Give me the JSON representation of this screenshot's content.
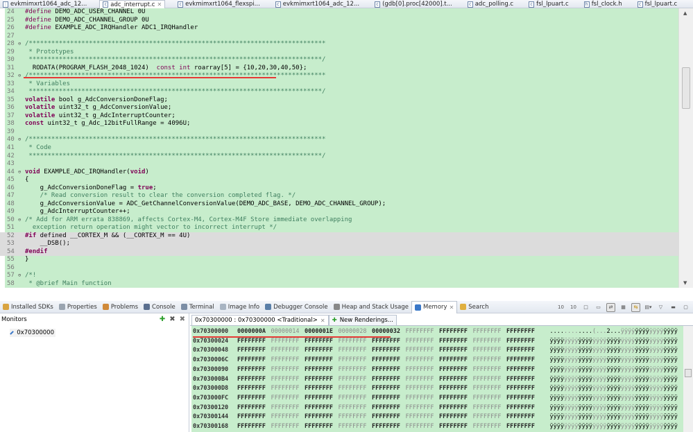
{
  "editor_tabs": [
    {
      "label": "evkmimxrt1064_adc_12...",
      "icon": "project-icon",
      "active": false
    },
    {
      "label": "adc_interrupt.c",
      "icon": "c-file-icon",
      "active": true
    },
    {
      "label": "evkmimxrt1064_flexspi...",
      "icon": "c-file-icon",
      "active": false
    },
    {
      "label": "evkmimxrt1064_adc_12...",
      "icon": "debug-file-icon",
      "active": false
    },
    {
      "label": "(gdb[0].proc[42000].t...",
      "icon": "c-file-icon",
      "active": false
    },
    {
      "label": "adc_polling.c",
      "icon": "c-file-icon",
      "active": false
    },
    {
      "label": "fsl_lpuart.c",
      "icon": "c-file-icon",
      "active": false
    },
    {
      "label": "fsl_clock.h",
      "icon": "h-file-icon",
      "active": false
    },
    {
      "label": "fsl_lpuart.c",
      "icon": "c-file-icon",
      "active": false
    }
  ],
  "code_lines": [
    {
      "n": "24",
      "seg": [
        [
          "kw2",
          "#define"
        ],
        [
          "",
          "DEMO_ADC_USER_CHANNEL 0U"
        ]
      ]
    },
    {
      "n": "25",
      "seg": [
        [
          "kw2",
          "#define"
        ],
        [
          "",
          "DEMO_ADC_CHANNEL_GROUP 0U"
        ]
      ]
    },
    {
      "n": "26",
      "seg": [
        [
          "kw2",
          "#define"
        ],
        [
          "",
          "EXAMPLE_ADC_IRQHandler ADC1_IRQHandler"
        ]
      ]
    },
    {
      "n": "27",
      "seg": []
    },
    {
      "n": "28",
      "fold": true,
      "seg": [
        [
          "cm",
          "/*******************************************************************************"
        ]
      ]
    },
    {
      "n": "29",
      "seg": [
        [
          "cm",
          " * Prototypes"
        ]
      ]
    },
    {
      "n": "30",
      "seg": [
        [
          "cm",
          " ******************************************************************************/"
        ]
      ]
    },
    {
      "n": "31",
      "seg": [
        [
          "",
          "  RODATA(PROGRAM_FLASH_2048_1024)  "
        ],
        [
          "kw2",
          "const int"
        ],
        [
          "",
          " roarray[5] = {10,20,30,40,50};"
        ]
      ]
    },
    {
      "n": "32",
      "fold": true,
      "seg": [
        [
          "cm",
          "/*******************************************************************************"
        ]
      ]
    },
    {
      "n": "33",
      "seg": [
        [
          "cm",
          " * Variables"
        ]
      ]
    },
    {
      "n": "34",
      "seg": [
        [
          "cm",
          " ******************************************************************************/"
        ]
      ]
    },
    {
      "n": "35",
      "seg": [
        [
          "kw",
          "volatile"
        ],
        [
          "",
          " bool g_AdcConversionDoneFlag;"
        ]
      ]
    },
    {
      "n": "36",
      "seg": [
        [
          "kw",
          "volatile"
        ],
        [
          "",
          " uint32_t g_AdcConversionValue;"
        ]
      ]
    },
    {
      "n": "37",
      "seg": [
        [
          "kw",
          "volatile"
        ],
        [
          "",
          " uint32_t g_AdcInterruptCounter;"
        ]
      ]
    },
    {
      "n": "38",
      "seg": [
        [
          "kw",
          "const"
        ],
        [
          "",
          " uint32_t g_Adc_12bitFullRange = 4096U;"
        ]
      ]
    },
    {
      "n": "39",
      "seg": []
    },
    {
      "n": "40",
      "fold": true,
      "seg": [
        [
          "cm",
          "/*******************************************************************************"
        ]
      ]
    },
    {
      "n": "41",
      "seg": [
        [
          "cm",
          " * Code"
        ]
      ]
    },
    {
      "n": "42",
      "seg": [
        [
          "cm",
          " ******************************************************************************/"
        ]
      ]
    },
    {
      "n": "43",
      "seg": []
    },
    {
      "n": "44",
      "fold": true,
      "seg": [
        [
          "kw",
          "void"
        ],
        [
          "",
          " EXAMPLE_ADC_IRQHandler("
        ],
        [
          "kw",
          "void"
        ],
        [
          "",
          ")"
        ]
      ]
    },
    {
      "n": "45",
      "seg": [
        [
          "",
          "{"
        ]
      ]
    },
    {
      "n": "46",
      "seg": [
        [
          "",
          "    g_AdcConversionDoneFlag = "
        ],
        [
          "kw",
          "true"
        ],
        [
          "",
          ";"
        ]
      ]
    },
    {
      "n": "47",
      "seg": [
        [
          "cm",
          "    /* Read conversion result to clear the conversion completed flag. */"
        ]
      ]
    },
    {
      "n": "48",
      "seg": [
        [
          "",
          "    g_AdcConversionValue = ADC_GetChannelConversionValue(DEMO_ADC_BASE, DEMO_ADC_CHANNEL_GROUP);"
        ]
      ]
    },
    {
      "n": "49",
      "seg": [
        [
          "",
          "    g_AdcInterruptCounter++;"
        ]
      ]
    },
    {
      "n": "50",
      "fold": true,
      "seg": [
        [
          "cm",
          "/* Add for ARM errata 838869, affects Cortex-M4, Cortex-M4F Store immediate overlapping"
        ]
      ]
    },
    {
      "n": "51",
      "seg": [
        [
          "cm",
          "  exception return operation might vector to incorrect interrupt */"
        ]
      ]
    },
    {
      "n": "52",
      "hl": true,
      "seg": [
        [
          "kw",
          "#if"
        ],
        [
          "",
          " defined __CORTEX_M && (__CORTEX_M == 4U)"
        ]
      ]
    },
    {
      "n": "53",
      "hl": true,
      "seg": [
        [
          "",
          "    __DSB();"
        ]
      ]
    },
    {
      "n": "54",
      "hl": true,
      "seg": [
        [
          "kw",
          "#endif"
        ]
      ]
    },
    {
      "n": "55",
      "seg": [
        [
          "",
          "}"
        ]
      ]
    },
    {
      "n": "56",
      "seg": []
    },
    {
      "n": "57",
      "fold": true,
      "seg": [
        [
          "cm",
          "/*!"
        ]
      ]
    },
    {
      "n": "58",
      "seg": [
        [
          "cm",
          " * @brief Main function"
        ]
      ]
    }
  ],
  "view_tabs": [
    {
      "label": "Installed SDKs",
      "icon": "sdk-icon",
      "color": "#d9a441"
    },
    {
      "label": "Properties",
      "icon": "properties-icon",
      "color": "#9aa4b0"
    },
    {
      "label": "Problems",
      "icon": "problems-icon",
      "color": "#d08a3a"
    },
    {
      "label": "Console",
      "icon": "console-icon",
      "color": "#5a6f8f"
    },
    {
      "label": "Terminal",
      "icon": "terminal-icon",
      "color": "#7c8ea6"
    },
    {
      "label": "Image Info",
      "icon": "image-info-icon",
      "color": "#a8b4c2"
    },
    {
      "label": "Debugger Console",
      "icon": "debugger-console-icon",
      "color": "#5a7fa8"
    },
    {
      "label": "Heap and Stack Usage",
      "icon": "heap-stack-icon",
      "color": "#888888"
    },
    {
      "label": "Memory",
      "icon": "memory-icon",
      "color": "#3a78c8",
      "active": true
    },
    {
      "label": "Search",
      "icon": "search-icon",
      "color": "#e0b040"
    }
  ],
  "monitors": {
    "title": "Monitors",
    "items": [
      "0x70300000"
    ]
  },
  "memory": {
    "tabs": [
      {
        "label": "0x70300000 : 0x70300000 <Traditional>",
        "active": true
      },
      {
        "label": "New Renderings...",
        "active": false
      }
    ],
    "rows": [
      {
        "addr": "0x70300000",
        "words": [
          "0000000A",
          "00000014",
          "0000001E",
          "00000028",
          "00000032",
          "FFFFFFFF",
          "FFFFFFFF",
          "FFFFFFFF",
          "FFFFFFFF"
        ],
        "ascii": "............(...2...ÿÿÿÿÿÿÿÿÿÿÿÿÿÿÿÿ"
      },
      {
        "addr": "0x70300024",
        "words": [
          "FFFFFFFF",
          "FFFFFFFF",
          "FFFFFFFF",
          "FFFFFFFF",
          "FFFFFFFF",
          "FFFFFFFF",
          "FFFFFFFF",
          "FFFFFFFF",
          "FFFFFFFF"
        ],
        "ascii": "ÿÿÿÿÿÿÿÿÿÿÿÿÿÿÿÿÿÿÿÿÿÿÿÿÿÿÿÿÿÿÿÿÿÿÿÿ"
      },
      {
        "addr": "0x70300048",
        "words": [
          "FFFFFFFF",
          "FFFFFFFF",
          "FFFFFFFF",
          "FFFFFFFF",
          "FFFFFFFF",
          "FFFFFFFF",
          "FFFFFFFF",
          "FFFFFFFF",
          "FFFFFFFF"
        ],
        "ascii": "ÿÿÿÿÿÿÿÿÿÿÿÿÿÿÿÿÿÿÿÿÿÿÿÿÿÿÿÿÿÿÿÿÿÿÿÿ"
      },
      {
        "addr": "0x7030006C",
        "words": [
          "FFFFFFFF",
          "FFFFFFFF",
          "FFFFFFFF",
          "FFFFFFFF",
          "FFFFFFFF",
          "FFFFFFFF",
          "FFFFFFFF",
          "FFFFFFFF",
          "FFFFFFFF"
        ],
        "ascii": "ÿÿÿÿÿÿÿÿÿÿÿÿÿÿÿÿÿÿÿÿÿÿÿÿÿÿÿÿÿÿÿÿÿÿÿÿ"
      },
      {
        "addr": "0x70300090",
        "words": [
          "FFFFFFFF",
          "FFFFFFFF",
          "FFFFFFFF",
          "FFFFFFFF",
          "FFFFFFFF",
          "FFFFFFFF",
          "FFFFFFFF",
          "FFFFFFFF",
          "FFFFFFFF"
        ],
        "ascii": "ÿÿÿÿÿÿÿÿÿÿÿÿÿÿÿÿÿÿÿÿÿÿÿÿÿÿÿÿÿÿÿÿÿÿÿÿ"
      },
      {
        "addr": "0x703000B4",
        "words": [
          "FFFFFFFF",
          "FFFFFFFF",
          "FFFFFFFF",
          "FFFFFFFF",
          "FFFFFFFF",
          "FFFFFFFF",
          "FFFFFFFF",
          "FFFFFFFF",
          "FFFFFFFF"
        ],
        "ascii": "ÿÿÿÿÿÿÿÿÿÿÿÿÿÿÿÿÿÿÿÿÿÿÿÿÿÿÿÿÿÿÿÿÿÿÿÿ"
      },
      {
        "addr": "0x703000D8",
        "words": [
          "FFFFFFFF",
          "FFFFFFFF",
          "FFFFFFFF",
          "FFFFFFFF",
          "FFFFFFFF",
          "FFFFFFFF",
          "FFFFFFFF",
          "FFFFFFFF",
          "FFFFFFFF"
        ],
        "ascii": "ÿÿÿÿÿÿÿÿÿÿÿÿÿÿÿÿÿÿÿÿÿÿÿÿÿÿÿÿÿÿÿÿÿÿÿÿ"
      },
      {
        "addr": "0x703000FC",
        "words": [
          "FFFFFFFF",
          "FFFFFFFF",
          "FFFFFFFF",
          "FFFFFFFF",
          "FFFFFFFF",
          "FFFFFFFF",
          "FFFFFFFF",
          "FFFFFFFF",
          "FFFFFFFF"
        ],
        "ascii": "ÿÿÿÿÿÿÿÿÿÿÿÿÿÿÿÿÿÿÿÿÿÿÿÿÿÿÿÿÿÿÿÿÿÿÿÿ"
      },
      {
        "addr": "0x70300120",
        "words": [
          "FFFFFFFF",
          "FFFFFFFF",
          "FFFFFFFF",
          "FFFFFFFF",
          "FFFFFFFF",
          "FFFFFFFF",
          "FFFFFFFF",
          "FFFFFFFF",
          "FFFFFFFF"
        ],
        "ascii": "ÿÿÿÿÿÿÿÿÿÿÿÿÿÿÿÿÿÿÿÿÿÿÿÿÿÿÿÿÿÿÿÿÿÿÿÿ"
      },
      {
        "addr": "0x70300144",
        "words": [
          "FFFFFFFF",
          "FFFFFFFF",
          "FFFFFFFF",
          "FFFFFFFF",
          "FFFFFFFF",
          "FFFFFFFF",
          "FFFFFFFF",
          "FFFFFFFF",
          "FFFFFFFF"
        ],
        "ascii": "ÿÿÿÿÿÿÿÿÿÿÿÿÿÿÿÿÿÿÿÿÿÿÿÿÿÿÿÿÿÿÿÿÿÿÿÿ"
      },
      {
        "addr": "0x70300168",
        "words": [
          "FFFFFFFF",
          "FFFFFFFF",
          "FFFFFFFF",
          "FFFFFFFF",
          "FFFFFFFF",
          "FFFFFFFF",
          "FFFFFFFF",
          "FFFFFFFF",
          "FFFFFFFF"
        ],
        "ascii": "ÿÿÿÿÿÿÿÿÿÿÿÿÿÿÿÿÿÿÿÿÿÿÿÿÿÿÿÿÿÿÿÿÿÿÿÿ"
      }
    ]
  },
  "colors": {
    "editor_bg": "#c7edcc",
    "highlight_line": "#dcdcdc",
    "annotation_red": "#e53935",
    "keyword": "#7f0055",
    "comment": "#3f7f5f"
  }
}
